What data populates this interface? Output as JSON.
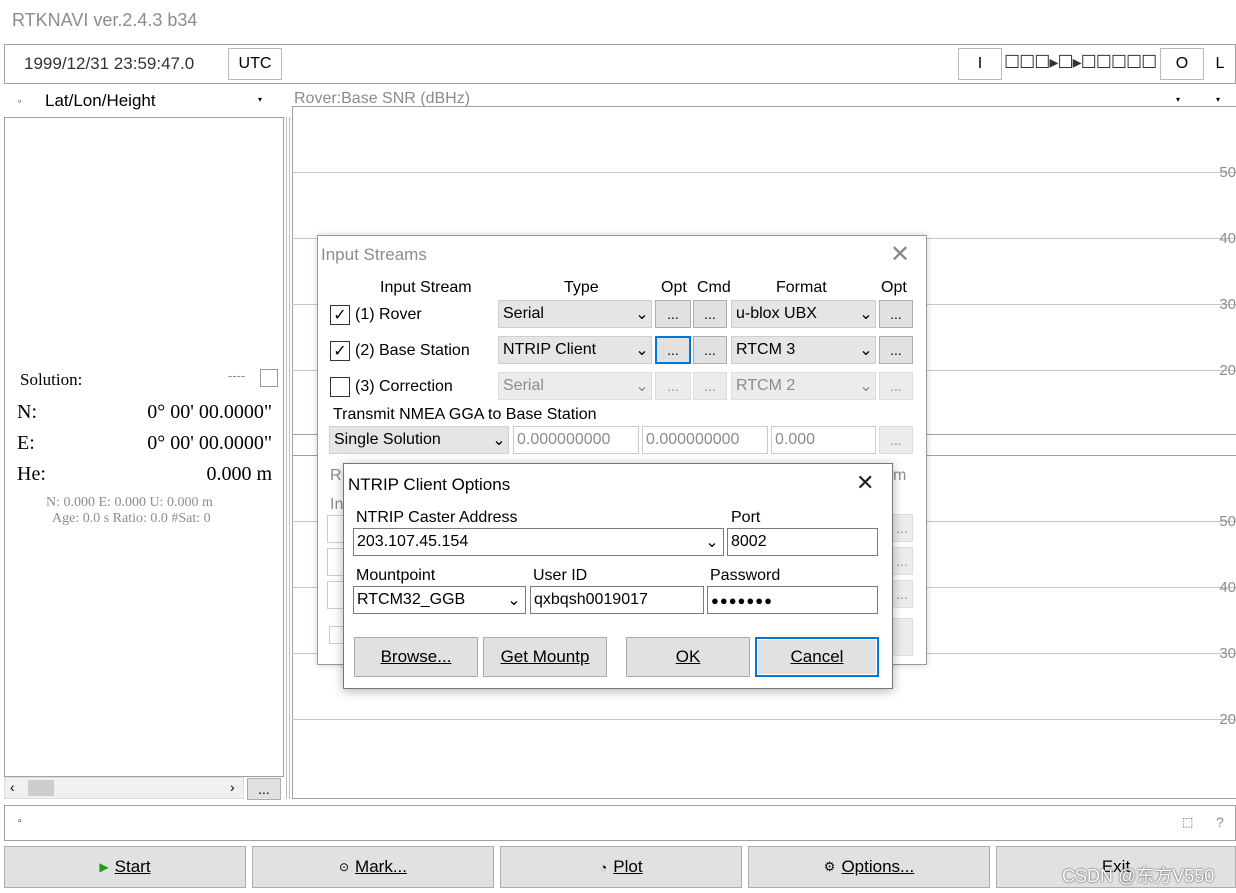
{
  "app": {
    "title": "RTKNAVI ver.2.4.3 b34"
  },
  "status_bar": {
    "datetime": "1999/12/31 23:59:47.0",
    "timezone": "UTC",
    "indicator_i": "I",
    "indicator_o": "O",
    "indicator_l": "L"
  },
  "left_panel": {
    "dropdown_value": "Lat/Lon/Height",
    "solution_label": "Solution:",
    "solution_status": "----",
    "n_label": "N:",
    "n_value": "0° 00' 00.0000\"",
    "e_label": "E:",
    "e_value": "0° 00' 00.0000\"",
    "he_label": "He:",
    "he_value": "0.000 m",
    "stats_line1": "N: 0.000 E: 0.000 U: 0.000 m",
    "stats_line2": "Age: 0.0 s Ratio: 0.0 #Sat: 0",
    "more_button": "..."
  },
  "plot": {
    "title": "Rover:Base  SNR (dBHz)",
    "ticks_upper": [
      "50",
      "40",
      "30",
      "20"
    ],
    "ticks_lower": [
      "50",
      "40",
      "30",
      "20"
    ]
  },
  "input_streams": {
    "title": "Input Streams",
    "headers": {
      "stream": "Input Stream",
      "type": "Type",
      "opt": "Opt",
      "cmd": "Cmd",
      "format": "Format",
      "opt2": "Opt"
    },
    "rows": [
      {
        "label": "(1) Rover",
        "checked": true,
        "type": "Serial",
        "format": "u-blox UBX",
        "enabled": true
      },
      {
        "label": "(2) Base Station",
        "checked": true,
        "type": "NTRIP Client",
        "format": "RTCM 3",
        "enabled": true
      },
      {
        "label": "(3) Correction",
        "checked": false,
        "type": "Serial",
        "format": "RTCM 2",
        "enabled": false
      }
    ],
    "btn": "...",
    "nmea_label": "Transmit NMEA GGA to Base Station",
    "nmea_mode": "Single Solution",
    "nmea_lat": "0.000000000",
    "nmea_lon": "0.000000000",
    "nmea_hgt": "0.000",
    "hidden_r": "R",
    "hidden_in": "In",
    "hidden_m": "m"
  },
  "ntrip": {
    "title": "NTRIP Client Options",
    "caster_label": "NTRIP Caster Address",
    "caster_value": "203.107.45.154",
    "port_label": "Port",
    "port_value": "8002",
    "mount_label": "Mountpoint",
    "mount_value": "RTCM32_GGB",
    "user_label": "User ID",
    "user_value": "qxbqsh0019017",
    "pass_label": "Password",
    "pass_value": "●●●●●●●",
    "browse": "Browse...",
    "getmount": "Get Mountp",
    "ok": "OK",
    "cancel": "Cancel"
  },
  "bottom": {
    "start": "Start",
    "mark": "Mark...",
    "plot": "Plot",
    "options": "Options...",
    "exit": "Exit",
    "help": "?"
  },
  "watermark": "CSDN @东方V550"
}
